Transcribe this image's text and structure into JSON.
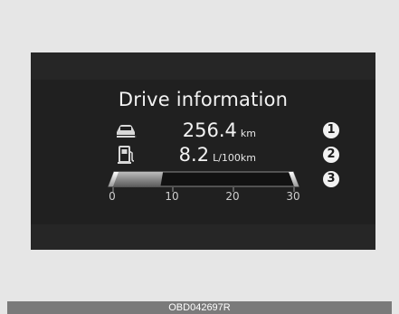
{
  "screen": {
    "title": "Drive information",
    "accent_color": "#f2f2f2",
    "background_color": "#1c1c1c"
  },
  "readouts": [
    {
      "icon": "car-distance-icon",
      "value": "256.4",
      "unit": "km",
      "badge": "1"
    },
    {
      "icon": "fuel-pump-icon",
      "value": "8.2",
      "unit": "L/100km",
      "badge": "2"
    }
  ],
  "gauge": {
    "badge": "3",
    "min": 0,
    "max": 30,
    "level": 8.2,
    "ticks": [
      "0",
      "10",
      "20",
      "30"
    ]
  },
  "caption": {
    "code": "OBD042697R"
  }
}
